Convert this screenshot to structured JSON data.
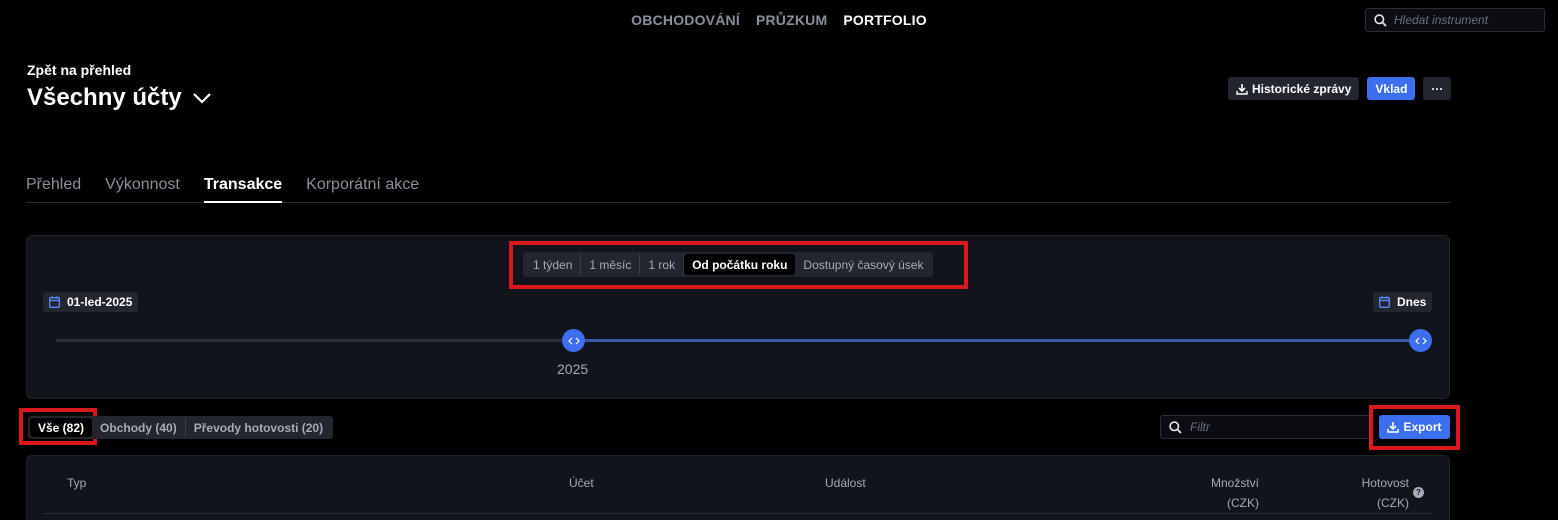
{
  "nav": {
    "items": [
      "OBCHODOVÁNÍ",
      "PRŮZKUM",
      "PORTFOLIO"
    ],
    "active": "PORTFOLIO"
  },
  "search": {
    "placeholder": "Hledat instrument"
  },
  "header": {
    "back_label": "Zpět na přehled",
    "title": "Všechny účty",
    "historical_reports_label": "Historické zprávy",
    "deposit_label": "Vklad",
    "more_label": "···"
  },
  "tabs": [
    "Přehled",
    "Výkonnost",
    "Transakce",
    "Korporátní akce"
  ],
  "active_tab": "Transakce",
  "timeline": {
    "ranges": [
      "1 týden",
      "1 měsíc",
      "1 rok",
      "Od počátku roku",
      "Dostupný časový úsek"
    ],
    "active_range": "Od počátku roku",
    "start_date": "01-led-2025",
    "end_date": "Dnes",
    "year_label": "2025"
  },
  "filters": {
    "buttons": [
      "Vše (82)",
      "Obchody (40)",
      "Převody hotovosti (20)"
    ],
    "active": "Vše (82)",
    "filter_placeholder": "Filtr",
    "export_label": "Export"
  },
  "table": {
    "col_type": "Typ",
    "col_account": "Účet",
    "col_event": "Událost",
    "col_quantity": "Množství",
    "col_quantity_unit": "(CZK)",
    "col_cash": "Hotovost",
    "col_cash_unit": "(CZK)",
    "help_icon": "?"
  },
  "colors": {
    "accent": "#3b6ff0",
    "highlight": "#d9181e",
    "card": "#12141b"
  }
}
